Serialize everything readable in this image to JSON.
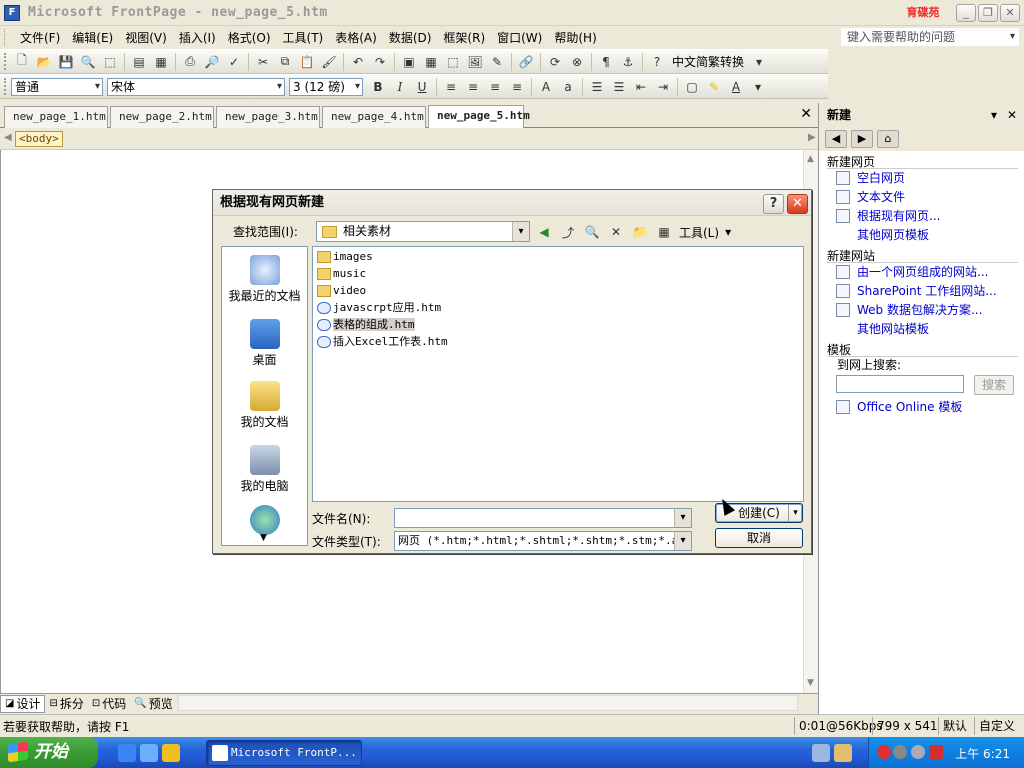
{
  "window": {
    "title": "Microsoft FrontPage - new_page_5.htm",
    "logo_text": "育碟苑",
    "controls": [
      "minimize",
      "restore",
      "close"
    ]
  },
  "menubar": {
    "items": [
      "文件(F)",
      "编辑(E)",
      "视图(V)",
      "插入(I)",
      "格式(O)",
      "工具(T)",
      "表格(A)",
      "数据(D)",
      "框架(R)",
      "窗口(W)",
      "帮助(H)"
    ],
    "help_placeholder": "键入需要帮助的问题"
  },
  "toolbar1": {
    "convert_label": "中文简繁转换"
  },
  "toolbar2": {
    "style": "普通",
    "font": "宋体",
    "size": "3 (12 磅)",
    "bold": "B",
    "italic": "I",
    "underline": "U"
  },
  "doc_tabs": [
    {
      "label": "new_page_1.htm",
      "active": false
    },
    {
      "label": "new_page_2.htm",
      "active": false
    },
    {
      "label": "new_page_3.htm",
      "active": false
    },
    {
      "label": "new_page_4.htm",
      "active": false
    },
    {
      "label": "new_page_5.htm",
      "active": true
    }
  ],
  "tag_bar": {
    "tag": "<body>"
  },
  "view_tabs": [
    {
      "label": "设计",
      "active": true
    },
    {
      "label": "拆分",
      "active": false
    },
    {
      "label": "代码",
      "active": false
    },
    {
      "label": "预览",
      "active": false
    }
  ],
  "statusbar": {
    "hint": "若要获取帮助，请按 F1",
    "speed": "0:01@56Kbps",
    "dimensions": "799 x 541",
    "mode": "默认",
    "custom": "自定义"
  },
  "taskpane": {
    "title": "新建",
    "sections": [
      {
        "title": "新建网页",
        "links": [
          "空白网页",
          "文本文件",
          "根据现有网页...",
          "其他网页模板"
        ]
      },
      {
        "title": "新建网站",
        "links": [
          "由一个网页组成的网站...",
          "SharePoint 工作组网站...",
          "Web 数据包解决方案...",
          "其他网站模板"
        ]
      }
    ],
    "templates": {
      "title": "模板",
      "search_label": "到网上搜索:",
      "search_button": "搜索",
      "office_online": "Office Online 模板"
    }
  },
  "dialog": {
    "title": "根据现有网页新建",
    "lookin_label": "查找范围(I):",
    "lookin_value": "相关素材",
    "tools_label": "工具(L)",
    "places": [
      "我最近的文档",
      "桌面",
      "我的文档",
      "我的电脑"
    ],
    "files": [
      {
        "name": "images",
        "type": "folder",
        "selected": false
      },
      {
        "name": "music",
        "type": "folder",
        "selected": false
      },
      {
        "name": "video",
        "type": "folder",
        "selected": false
      },
      {
        "name": "javascrpt应用.htm",
        "type": "htm",
        "selected": false
      },
      {
        "name": "表格的组成.htm",
        "type": "htm",
        "selected": true
      },
      {
        "name": "插入Excel工作表.htm",
        "type": "htm",
        "selected": false
      }
    ],
    "filename_label": "文件名(N):",
    "filename_value": "",
    "filetype_label": "文件类型(T):",
    "filetype_value": "网页 (*.htm;*.html;*.shtml;*.shtm;*.stm;*.asp;*",
    "create_button": "创建(C)",
    "cancel_button": "取消"
  },
  "taskbar": {
    "start_label": "开始",
    "active_task": "Microsoft FrontP...",
    "clock": "上午 6:21"
  }
}
